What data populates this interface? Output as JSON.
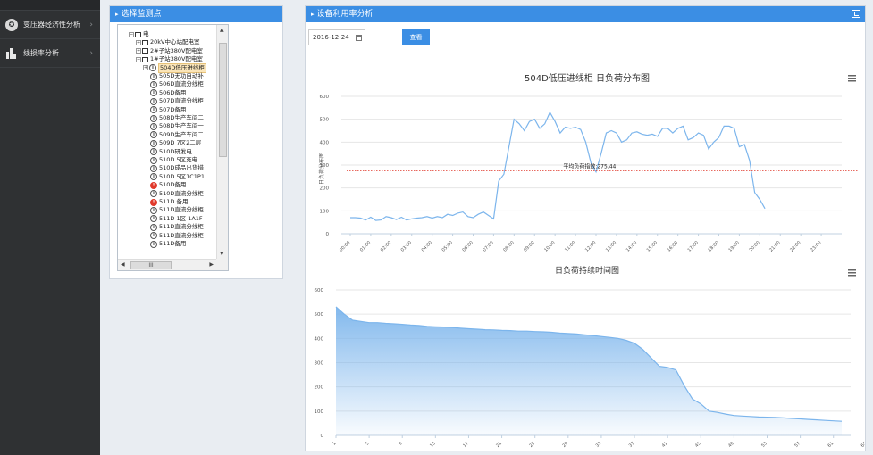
{
  "sidebar": {
    "items": [
      {
        "label": "变压器经济性分析",
        "icon": "transformer-icon"
      },
      {
        "label": "线损率分析",
        "icon": "bar-chart-icon"
      }
    ]
  },
  "left_panel": {
    "title": "选择监测点",
    "tree": [
      {
        "text": "电",
        "type": "folder",
        "exp": "⊟",
        "indent": 0
      },
      {
        "text": "20kV中心站配电室",
        "type": "folder",
        "exp": "⊞",
        "indent": 1
      },
      {
        "text": "2#子站380V配电室",
        "type": "folder",
        "exp": "⊞",
        "indent": 1
      },
      {
        "text": "1#子站380V配电室",
        "type": "folder",
        "exp": "⊟",
        "indent": 1
      },
      {
        "text": "504D低压进线柜",
        "type": "meter",
        "exp": "⊞",
        "indent": 2,
        "selected": true
      },
      {
        "text": "505D无功自动补",
        "type": "meter",
        "indent": 3
      },
      {
        "text": "506D直流分线柜",
        "type": "meter",
        "indent": 3
      },
      {
        "text": "506D备用",
        "type": "meter",
        "indent": 3
      },
      {
        "text": "507D直流分线柜",
        "type": "meter",
        "indent": 3
      },
      {
        "text": "507D备用",
        "type": "meter",
        "indent": 3
      },
      {
        "text": "508D生产车间二",
        "type": "meter",
        "indent": 3
      },
      {
        "text": "508D生产车间一",
        "type": "meter",
        "indent": 3
      },
      {
        "text": "509D生产车间二",
        "type": "meter",
        "indent": 3
      },
      {
        "text": "509D 7区2二层",
        "type": "meter",
        "indent": 3
      },
      {
        "text": "510D研发电",
        "type": "meter",
        "indent": 3
      },
      {
        "text": "510D 5区充电",
        "type": "meter",
        "indent": 3
      },
      {
        "text": "510D成品出货措",
        "type": "meter",
        "indent": 3
      },
      {
        "text": "510D 5区1C1P1",
        "type": "meter",
        "indent": 3
      },
      {
        "text": "510D备用",
        "type": "alarm",
        "indent": 3
      },
      {
        "text": "510D直流分线柜",
        "type": "meter",
        "indent": 3
      },
      {
        "text": "511D 备用",
        "type": "alarm",
        "indent": 3
      },
      {
        "text": "511D直流分线柜",
        "type": "meter",
        "indent": 3
      },
      {
        "text": "511D 1区 1A1F",
        "type": "meter",
        "indent": 3
      },
      {
        "text": "511D直流分线柜",
        "type": "meter",
        "indent": 3
      },
      {
        "text": "511D直流分线柜",
        "type": "meter",
        "indent": 3
      },
      {
        "text": "511D备用",
        "type": "meter",
        "indent": 3
      }
    ],
    "hscroll_label": "III"
  },
  "right_panel": {
    "title": "设备利用率分析",
    "date_value": "2016-12-24",
    "search_label": "查看"
  },
  "colors": {
    "accent": "#3b8ee4",
    "line": "#7cb5ec",
    "avg_line": "#e0392b"
  },
  "chart_data": [
    {
      "type": "line",
      "title": "504D低压进线柜 日负荷分布图",
      "ylabel": "日负荷分布图",
      "ylim": [
        0,
        600
      ],
      "yticks": [
        "0",
        "100",
        "200",
        "300",
        "400",
        "500",
        "600"
      ],
      "xlabels": [
        "00:00",
        "01:00",
        "02:00",
        "03:00",
        "04:00",
        "05:00",
        "06:00",
        "07:00",
        "08:00",
        "09:00",
        "10:00",
        "11:00",
        "12:00",
        "13:00",
        "14:00",
        "15:00",
        "16:00",
        "17:00",
        "18:00",
        "19:00",
        "20:00",
        "21:00",
        "22:00",
        "23:00"
      ],
      "x_step_hours": 0.25,
      "values": [
        70,
        70,
        68,
        60,
        72,
        58,
        60,
        75,
        70,
        62,
        72,
        60,
        65,
        68,
        70,
        75,
        68,
        75,
        70,
        85,
        80,
        90,
        95,
        75,
        70,
        85,
        95,
        80,
        65,
        230,
        260,
        380,
        500,
        480,
        450,
        490,
        500,
        460,
        480,
        530,
        490,
        440,
        465,
        460,
        465,
        455,
        400,
        310,
        270,
        350,
        440,
        450,
        440,
        400,
        410,
        440,
        445,
        435,
        430,
        435,
        425,
        460,
        460,
        440,
        460,
        470,
        410,
        420,
        440,
        430,
        370,
        400,
        420,
        470,
        470,
        460,
        380,
        390,
        320,
        180,
        150,
        110
      ],
      "avg_value": 275.44,
      "avg_label": "平均负荷指数:275.44"
    },
    {
      "type": "area",
      "title": "日负荷持续时间图",
      "ylim": [
        0,
        600
      ],
      "yticks": [
        "0",
        "100",
        "200",
        "300",
        "400",
        "500",
        "600"
      ],
      "xlabels": [
        "1",
        "5",
        "9",
        "13",
        "17",
        "21",
        "25",
        "29",
        "33",
        "37",
        "41",
        "45",
        "49",
        "53",
        "57",
        "61",
        "65",
        "69",
        "73",
        "77",
        "81"
      ],
      "values": [
        530,
        500,
        475,
        470,
        465,
        465,
        462,
        460,
        458,
        455,
        453,
        450,
        448,
        447,
        445,
        442,
        440,
        438,
        436,
        435,
        433,
        432,
        430,
        430,
        428,
        427,
        425,
        422,
        420,
        418,
        415,
        412,
        408,
        404,
        400,
        392,
        380,
        355,
        320,
        285,
        280,
        270,
        205,
        150,
        130,
        100,
        95,
        88,
        82,
        80,
        78,
        76,
        75,
        74,
        72,
        70,
        68,
        66,
        64,
        62,
        60,
        58
      ]
    }
  ]
}
